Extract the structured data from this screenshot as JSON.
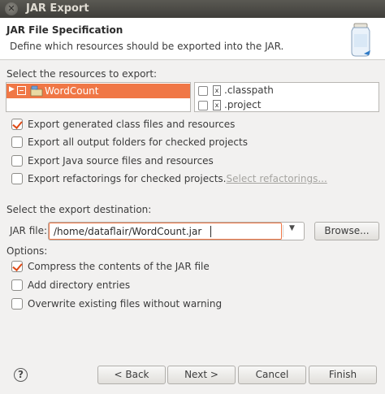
{
  "window": {
    "title": "JAR Export",
    "close_glyph": "✕"
  },
  "banner": {
    "title": "JAR File Specification",
    "description": "Define which resources should be exported into the JAR.",
    "icon": "jar-icon"
  },
  "resources": {
    "label": "Select the resources to export:",
    "tree": [
      {
        "label": "WordCount",
        "checked": "partial",
        "selected": true,
        "icon": "java-project-icon"
      }
    ],
    "files": [
      {
        "name": ".classpath",
        "checked": false,
        "icon": "xml-file-icon"
      },
      {
        "name": ".project",
        "checked": false,
        "icon": "xml-file-icon"
      }
    ]
  },
  "export_options": [
    {
      "label": "Export generated class files and resources",
      "checked": true
    },
    {
      "label": "Export all output folders for checked projects",
      "checked": false
    },
    {
      "label": "Export Java source files and resources",
      "checked": false
    },
    {
      "label": "Export refactorings for checked projects.",
      "checked": false,
      "link": "Select refactorings..."
    }
  ],
  "destination": {
    "label": "Select the export destination:",
    "field_label": "JAR file:",
    "value": "/home/dataflair/WordCount.jar",
    "browse_label": "Browse..."
  },
  "options": {
    "label": "Options:",
    "items": [
      {
        "label": "Compress the contents of the JAR file",
        "checked": true
      },
      {
        "label": "Add directory entries",
        "checked": false
      },
      {
        "label": "Overwrite existing files without warning",
        "checked": false
      }
    ]
  },
  "footer": {
    "help_glyph": "?",
    "back_label": "< Back",
    "next_label": "Next >",
    "cancel_label": "Cancel",
    "finish_label": "Finish"
  },
  "colors": {
    "accent": "#f07746",
    "check": "#df4a16",
    "titlebar": "#4a4944"
  }
}
